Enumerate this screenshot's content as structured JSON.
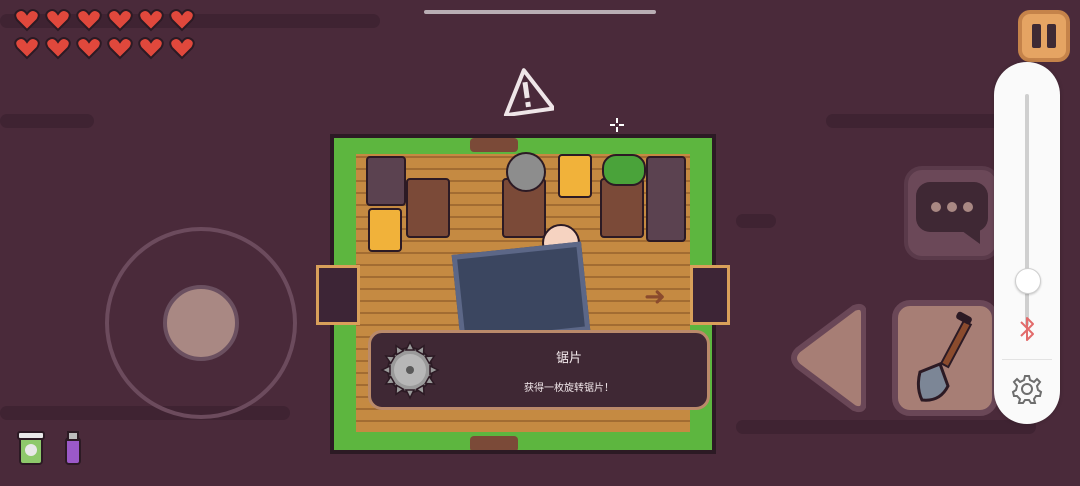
{
  "hud": {
    "hearts_filled": 12,
    "hearts_total": 12,
    "heart_color": "#e0483c"
  },
  "pickup_dialog": {
    "item_icon": "circular-saw-blade-icon",
    "title": "锯片",
    "description": "获得一枚旋转锯片！"
  },
  "inventory": {
    "items": [
      "drink-cup-icon",
      "lighter-icon"
    ]
  },
  "controls": {
    "pause_icon": "pause-icon",
    "chat_icon": "speech-bubble-icon",
    "move_left_icon": "triangle-left-icon",
    "dig_icon": "shovel-icon"
  },
  "side_panel": {
    "bluetooth_icon": "bluetooth-icon",
    "settings_icon": "gear-icon",
    "volume_level": 0.2
  },
  "colors": {
    "background": "#4a2a3a",
    "grass": "#5db63f",
    "floor": "#c58a42",
    "button_accent": "#e5a463"
  }
}
